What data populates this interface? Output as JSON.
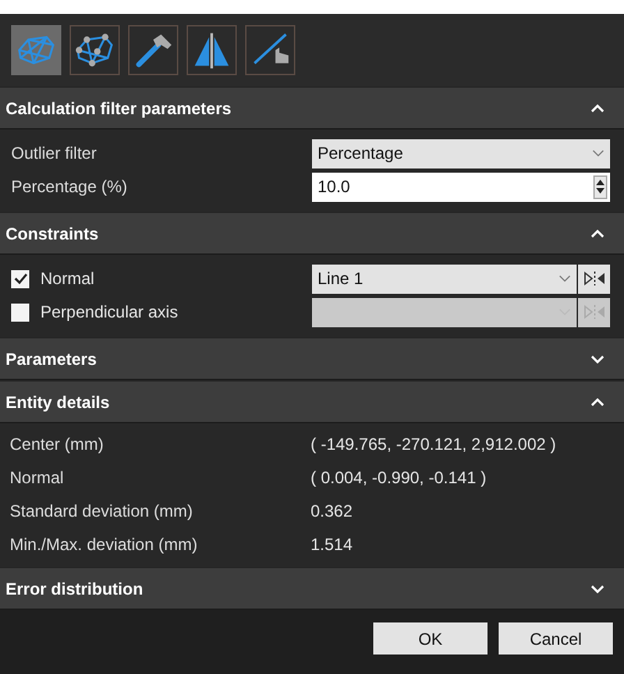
{
  "toolbar": [
    {
      "selected": true
    },
    {
      "selected": false
    },
    {
      "selected": false
    },
    {
      "selected": false
    },
    {
      "selected": false
    }
  ],
  "sections": [
    {
      "title": "Calculation filter parameters",
      "expanded": true,
      "kind": "form",
      "rows": [
        {
          "label": "Outlier filter",
          "kind": "dropdown",
          "value": "Percentage"
        },
        {
          "label": "Percentage (%)",
          "kind": "spin",
          "value": "10.0"
        }
      ]
    },
    {
      "title": "Constraints",
      "expanded": true,
      "kind": "constraints",
      "rows": [
        {
          "label": "Normal",
          "checked": true,
          "value": "Line 1"
        },
        {
          "label": "Perpendicular axis",
          "checked": false
        }
      ]
    },
    {
      "title": "Parameters",
      "expanded": false,
      "kind": "none"
    },
    {
      "title": "Entity details",
      "expanded": true,
      "kind": "details",
      "rows": [
        {
          "label": "Center (mm)",
          "value": "( -149.765, -270.121, 2,912.002 )"
        },
        {
          "label": "Normal",
          "value": "( 0.004, -0.990, -0.141 )"
        },
        {
          "label": "Standard deviation (mm)",
          "value": "0.362"
        },
        {
          "label": "Min./Max. deviation (mm)",
          "value": "1.514"
        }
      ]
    },
    {
      "title": "Error distribution",
      "expanded": false,
      "kind": "none"
    }
  ],
  "buttons": [
    "OK",
    "Cancel"
  ]
}
